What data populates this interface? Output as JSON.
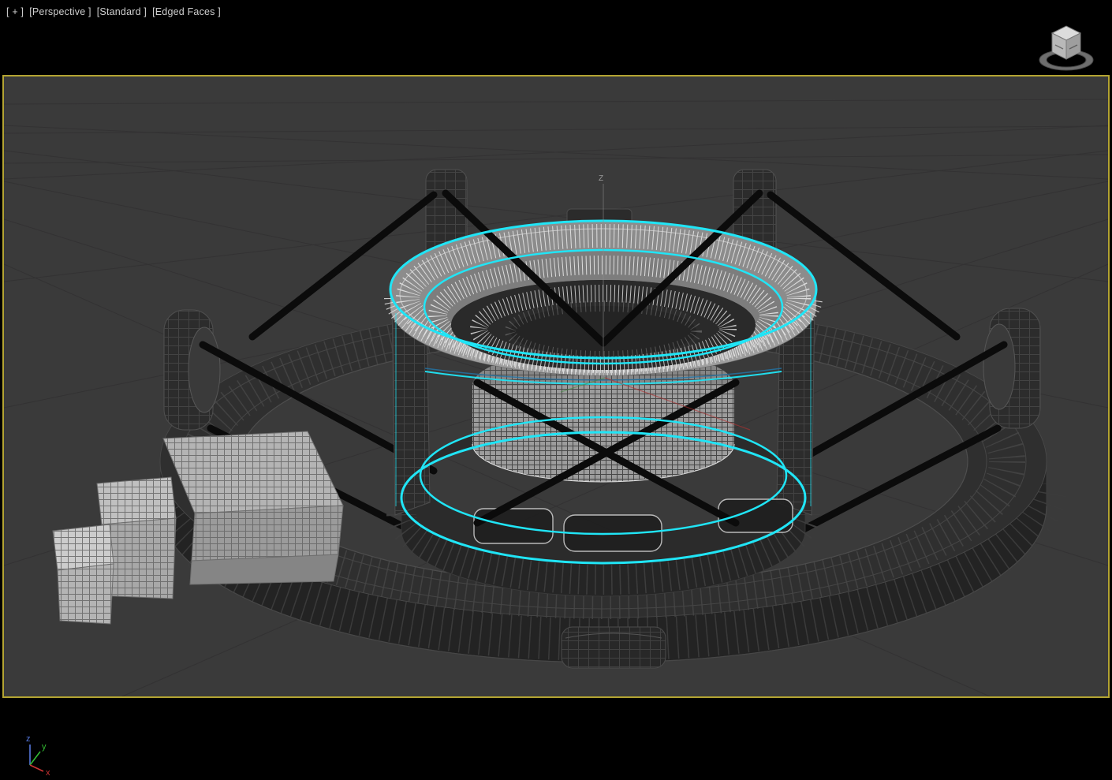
{
  "viewport_label": {
    "general_menu": "[ + ]",
    "pov_menu": "[Perspective ]",
    "render_preset_menu": "[Standard ]",
    "shading_menu": "[Edged Faces ]"
  },
  "gizmo": {
    "z_axis_label": "Z"
  },
  "axis_tripod": {
    "x_label": "x",
    "y_label": "y",
    "z_label": "z"
  },
  "colors": {
    "viewport_border": "#b3a432",
    "viewport_bg": "#3a3a3a",
    "chrome_bg": "#000000",
    "label_text": "#cfcfcf",
    "selection_cyan": "#20e5f6",
    "strap_black": "#0b0b0b",
    "wire_light": "#e6e6e6",
    "geo_dark": "#2e2e2e",
    "axis_x_red": "#cc3333",
    "axis_y_green": "#33bb33",
    "axis_z_blue": "#5577dd"
  }
}
